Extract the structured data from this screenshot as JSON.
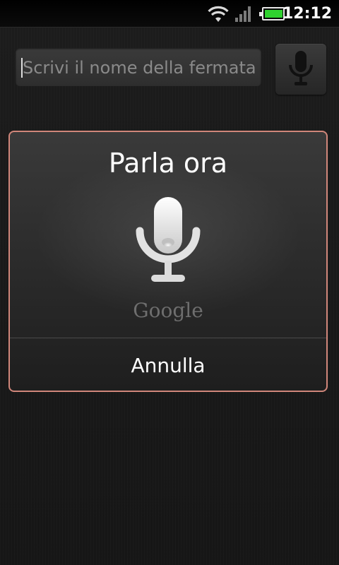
{
  "status_bar": {
    "time": "12:12",
    "icons": [
      "wifi-icon",
      "signal-icon",
      "battery-charging-icon"
    ],
    "battery_color": "#2fd12f"
  },
  "search": {
    "placeholder": "Scrivi il nome della fermata",
    "value": "",
    "mic_icon": "microphone-icon"
  },
  "voice_dialog": {
    "title": "Parla ora",
    "mic_icon": "microphone-icon",
    "brand": "Google",
    "cancel_label": "Annulla",
    "border_color": "#d0867a"
  }
}
